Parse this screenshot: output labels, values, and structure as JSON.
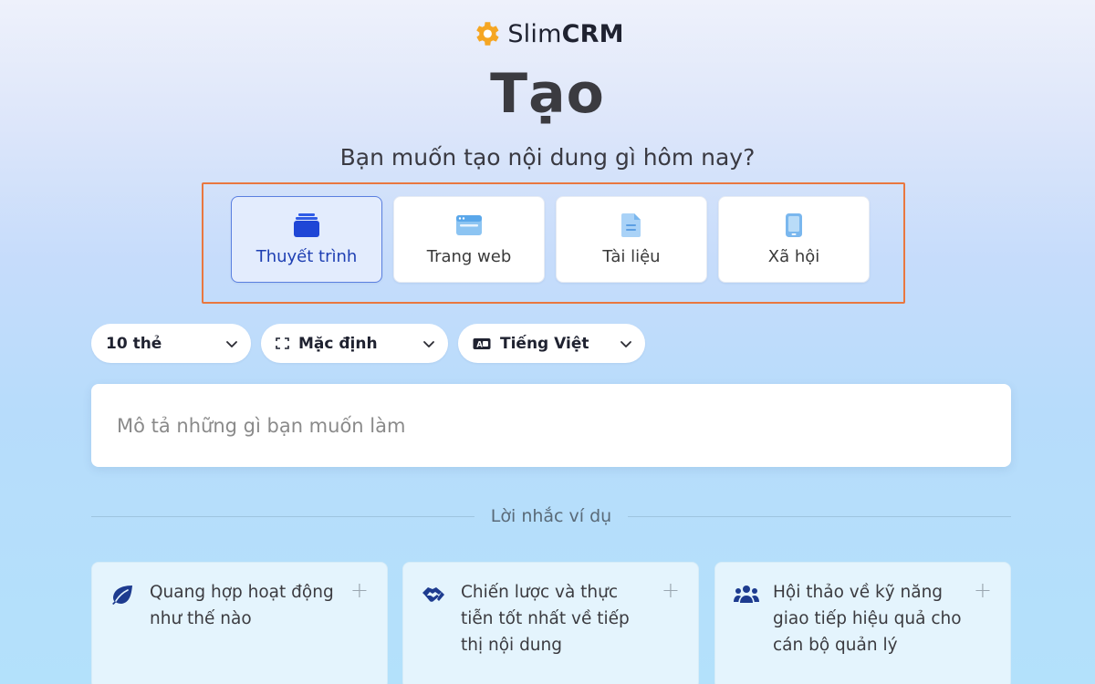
{
  "brand": {
    "name_light": "Slim",
    "name_bold": "CRM",
    "icon": "gear-icon",
    "icon_color": "#f5a623"
  },
  "page": {
    "title": "Tạo",
    "subtitle": "Bạn muốn tạo nội dung gì hôm nay?"
  },
  "content_types": [
    {
      "label": "Thuyết trình",
      "icon": "presentation-icon",
      "selected": true
    },
    {
      "label": "Trang web",
      "icon": "webpage-icon",
      "selected": false
    },
    {
      "label": "Tài liệu",
      "icon": "document-icon",
      "selected": false
    },
    {
      "label": "Xã hội",
      "icon": "phone-icon",
      "selected": false
    }
  ],
  "options": {
    "cards": {
      "value": "10 thẻ"
    },
    "layout": {
      "value": "Mặc định",
      "icon": "frame-icon"
    },
    "language": {
      "value": "Tiếng Việt",
      "icon": "language-icon"
    }
  },
  "prompt": {
    "placeholder": "Mô tả những gì bạn muốn làm",
    "value": ""
  },
  "examples": {
    "heading": "Lời nhắc ví dụ",
    "items": [
      {
        "text": "Quang hợp hoạt động như thế nào",
        "icon": "leaf-icon"
      },
      {
        "text": "Chiến lược và thực tiễn tốt nhất về tiếp thị nội dung",
        "icon": "handshake-icon"
      },
      {
        "text": "Hội thảo về kỹ năng giao tiếp hiệu quả cho cán bộ quản lý",
        "icon": "group-icon"
      }
    ],
    "add_symbol": "+"
  },
  "colors": {
    "accent": "#1e3fb3",
    "highlight_frame": "#e9773f",
    "selected_bg": "#e3ecfd"
  }
}
